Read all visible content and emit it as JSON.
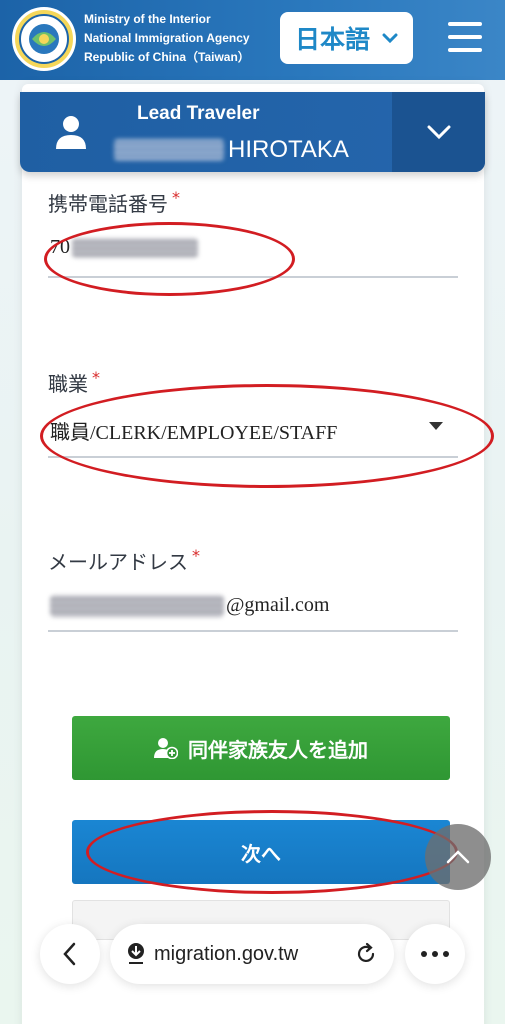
{
  "header": {
    "agency_line1": "Ministry of the Interior",
    "agency_line2": "National Immigration Agency",
    "agency_line3": "Republic of China（Taiwan）",
    "language": "日本語"
  },
  "lead": {
    "title": "Lead Traveler",
    "name_visible": "HIROTAKA"
  },
  "form": {
    "phone": {
      "label": "携帯電話番号",
      "required": "*",
      "value_prefix": "70"
    },
    "occupation": {
      "label": "職業",
      "required": "*",
      "value": "職員/CLERK/EMPLOYEE/STAFF"
    },
    "email": {
      "label": "メールアドレス",
      "required": "*",
      "value_suffix": "@gmail.com"
    }
  },
  "buttons": {
    "add_companion": "同伴家族友人を追加",
    "next": "次へ"
  },
  "browser": {
    "url": "migration.gov.tw"
  },
  "colors": {
    "header_blue": "#1c63a8",
    "lead_bar": "#1f5fa3",
    "add_green": "#3ea83f",
    "next_blue": "#1a86d3",
    "required_red": "#d82a2a",
    "annotation_red": "#d21d22"
  }
}
